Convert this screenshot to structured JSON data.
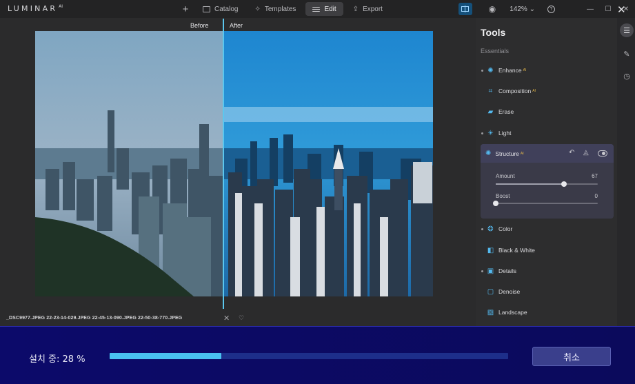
{
  "app": {
    "logo": "LUMINAR",
    "logo_sup": "AI"
  },
  "topnav": {
    "items": [
      {
        "label": "Catalog",
        "icon": "folder-icon"
      },
      {
        "label": "Templates",
        "icon": "sparkle-icon"
      },
      {
        "label": "Edit",
        "icon": "sliders-icon",
        "active": true
      },
      {
        "label": "Export",
        "icon": "upload-icon"
      }
    ],
    "zoom": "142%"
  },
  "canvas": {
    "before_label": "Before",
    "after_label": "After",
    "split_position": 0.47,
    "filename": "_DSC9977.JPEG 22-23-14-029.JPEG 22-45-13-090.JPEG 22-50-38-770.JPEG"
  },
  "tools": {
    "title": "Tools",
    "section": "Essentials",
    "items": [
      {
        "label": "Enhance",
        "ai": "AI",
        "dot": true
      },
      {
        "label": "Composition",
        "ai": "AI",
        "dot": false
      },
      {
        "label": "Erase",
        "ai": "",
        "dot": false
      },
      {
        "label": "Light",
        "ai": "",
        "dot": true
      },
      {
        "label": "Color",
        "ai": "",
        "dot": true
      },
      {
        "label": "Black & White",
        "ai": "",
        "dot": false
      },
      {
        "label": "Details",
        "ai": "",
        "dot": true
      },
      {
        "label": "Denoise",
        "ai": "",
        "dot": false
      },
      {
        "label": "Landscape",
        "ai": "",
        "dot": false
      }
    ],
    "structure": {
      "label": "Structure",
      "ai": "AI",
      "amount_label": "Amount",
      "amount_value": "67",
      "amount_fraction": 0.67,
      "boost_label": "Boost",
      "boost_value": "0",
      "boost_fraction": 0.0
    }
  },
  "install": {
    "status": "설치 중: 28 %",
    "progress": 0.28,
    "cancel_label": "취소"
  },
  "colors": {
    "accent": "#54b9ee",
    "install_bg": "#0c0a6a",
    "progress_fill": "#49c2f0"
  }
}
